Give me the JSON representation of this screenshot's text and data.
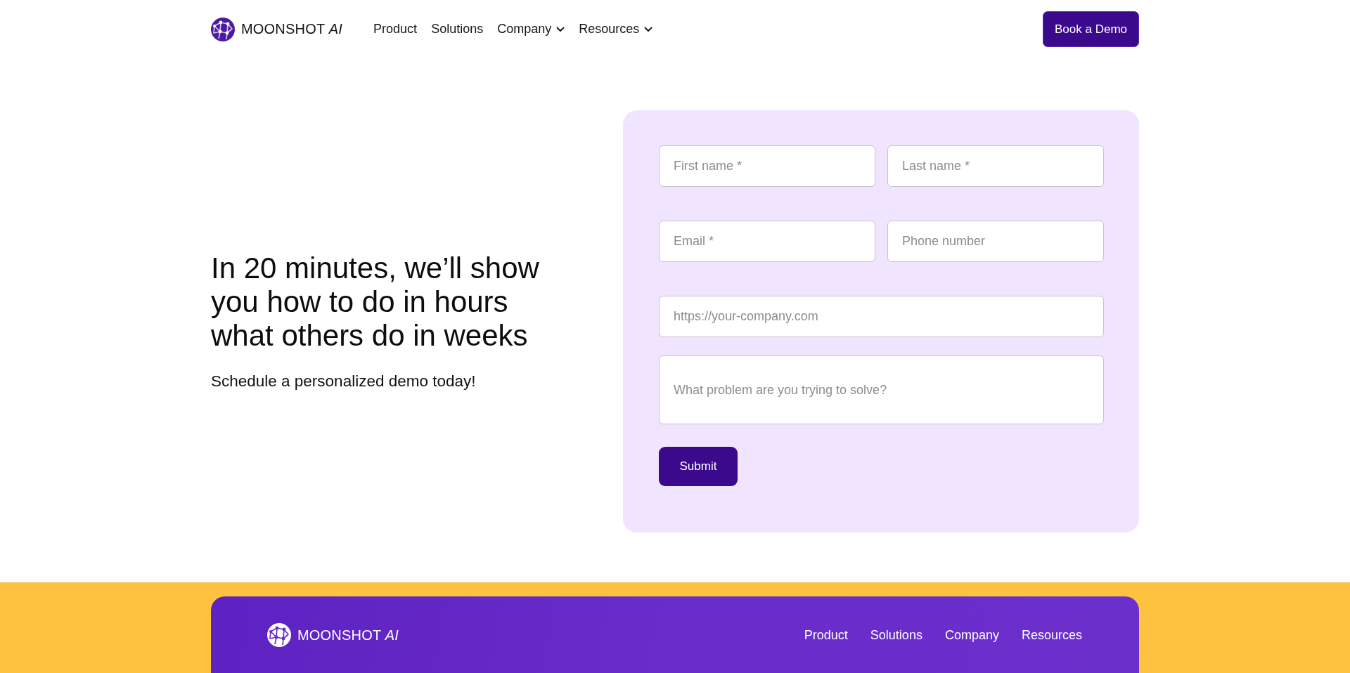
{
  "header": {
    "logo": {
      "text": "MOONSHOT *AI*"
    },
    "nav": [
      {
        "label": "Product",
        "dropdown": false
      },
      {
        "label": "Solutions",
        "dropdown": false
      },
      {
        "label": "Company",
        "dropdown": true
      },
      {
        "label": "Resources",
        "dropdown": true
      }
    ],
    "cta": "Book a Demo"
  },
  "hero": {
    "heading": "In 20 minutes, we’ll show you how to do in hours what others do in weeks",
    "subheading": "Schedule a personalized demo today!"
  },
  "form": {
    "rows": [
      {
        "fields": [
          {
            "kind": "input",
            "placeholder": "First name *"
          },
          {
            "kind": "input",
            "placeholder": "Last name *"
          }
        ]
      },
      {
        "fields": [
          {
            "kind": "input",
            "placeholder": "Email *"
          },
          {
            "kind": "input",
            "placeholder": "Phone number"
          }
        ]
      },
      {
        "fields": [
          {
            "kind": "input",
            "placeholder": "https://your-company.com"
          }
        ]
      },
      {
        "fields": [
          {
            "kind": "textarea",
            "placeholder": "What problem are you trying to solve?"
          }
        ]
      }
    ],
    "submit": "Submit"
  },
  "footer": {
    "logo": {
      "text": "MOONSHOT *AI*"
    },
    "nav": [
      "Product",
      "Solutions",
      "Company",
      "Resources"
    ]
  }
}
